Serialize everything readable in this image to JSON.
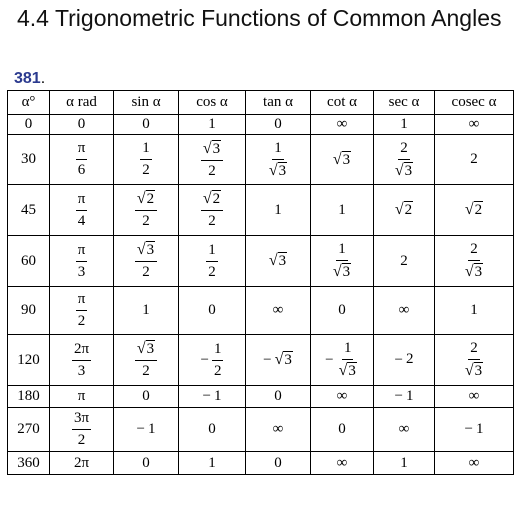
{
  "title": "4.4 Trigonometric Functions of Common Angles",
  "label_number": "381",
  "label_dot": ".",
  "headers": [
    "α°",
    "α rad",
    "sin α",
    "cos α",
    "tan α",
    "cot α",
    "sec α",
    "cosec α"
  ],
  "rows": [
    [
      "0",
      "0",
      "0",
      "1",
      "0",
      "∞",
      "1",
      "∞"
    ],
    [
      "30",
      "π/6",
      "1/2",
      "√3/2",
      "1/√3",
      "√3",
      "2/√3",
      "2"
    ],
    [
      "45",
      "π/4",
      "√2/2",
      "√2/2",
      "1",
      "1",
      "√2",
      "√2"
    ],
    [
      "60",
      "π/3",
      "√3/2",
      "1/2",
      "√3",
      "1/√3",
      "2",
      "2/√3"
    ],
    [
      "90",
      "π/2",
      "1",
      "0",
      "∞",
      "0",
      "∞",
      "1"
    ],
    [
      "120",
      "2π/3",
      "√3/2",
      "-1/2",
      "-√3",
      "-1/√3",
      "-2",
      "2/√3"
    ],
    [
      "180",
      "π",
      "0",
      "-1",
      "0",
      "∞",
      "-1",
      "∞"
    ],
    [
      "270",
      "3π/2",
      "-1",
      "0",
      "∞",
      "0",
      "∞",
      "-1"
    ],
    [
      "360",
      "2π",
      "0",
      "1",
      "0",
      "∞",
      "1",
      "∞"
    ]
  ]
}
